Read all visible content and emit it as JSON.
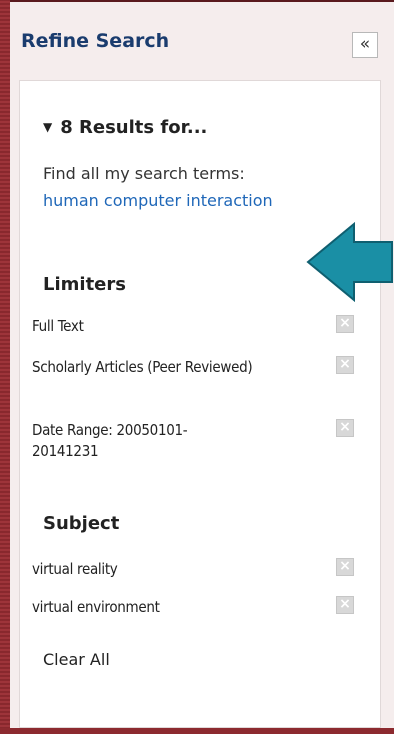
{
  "panel": {
    "title": "Refine Search",
    "collapse_label": "«"
  },
  "results": {
    "triangle": "▼",
    "heading": "8 Results for...",
    "find_label": "Find all my search terms:",
    "find_value": "human computer interaction"
  },
  "limiters": {
    "heading": "Limiters",
    "items": [
      {
        "label": "Full Text"
      },
      {
        "label": "Scholarly Articles (Peer Reviewed)"
      },
      {
        "label": "Date Range: 20050101-20141231"
      }
    ]
  },
  "subject": {
    "heading": "Subject",
    "items": [
      {
        "label": "virtual reality"
      },
      {
        "label": "virtual environment"
      }
    ]
  },
  "remove_glyph": "×",
  "clear_all": "Clear All",
  "colors": {
    "background": "#8c2a2f",
    "title": "#1a3c6e",
    "link": "#1f67b8",
    "arrow": "#1a8fa5"
  }
}
